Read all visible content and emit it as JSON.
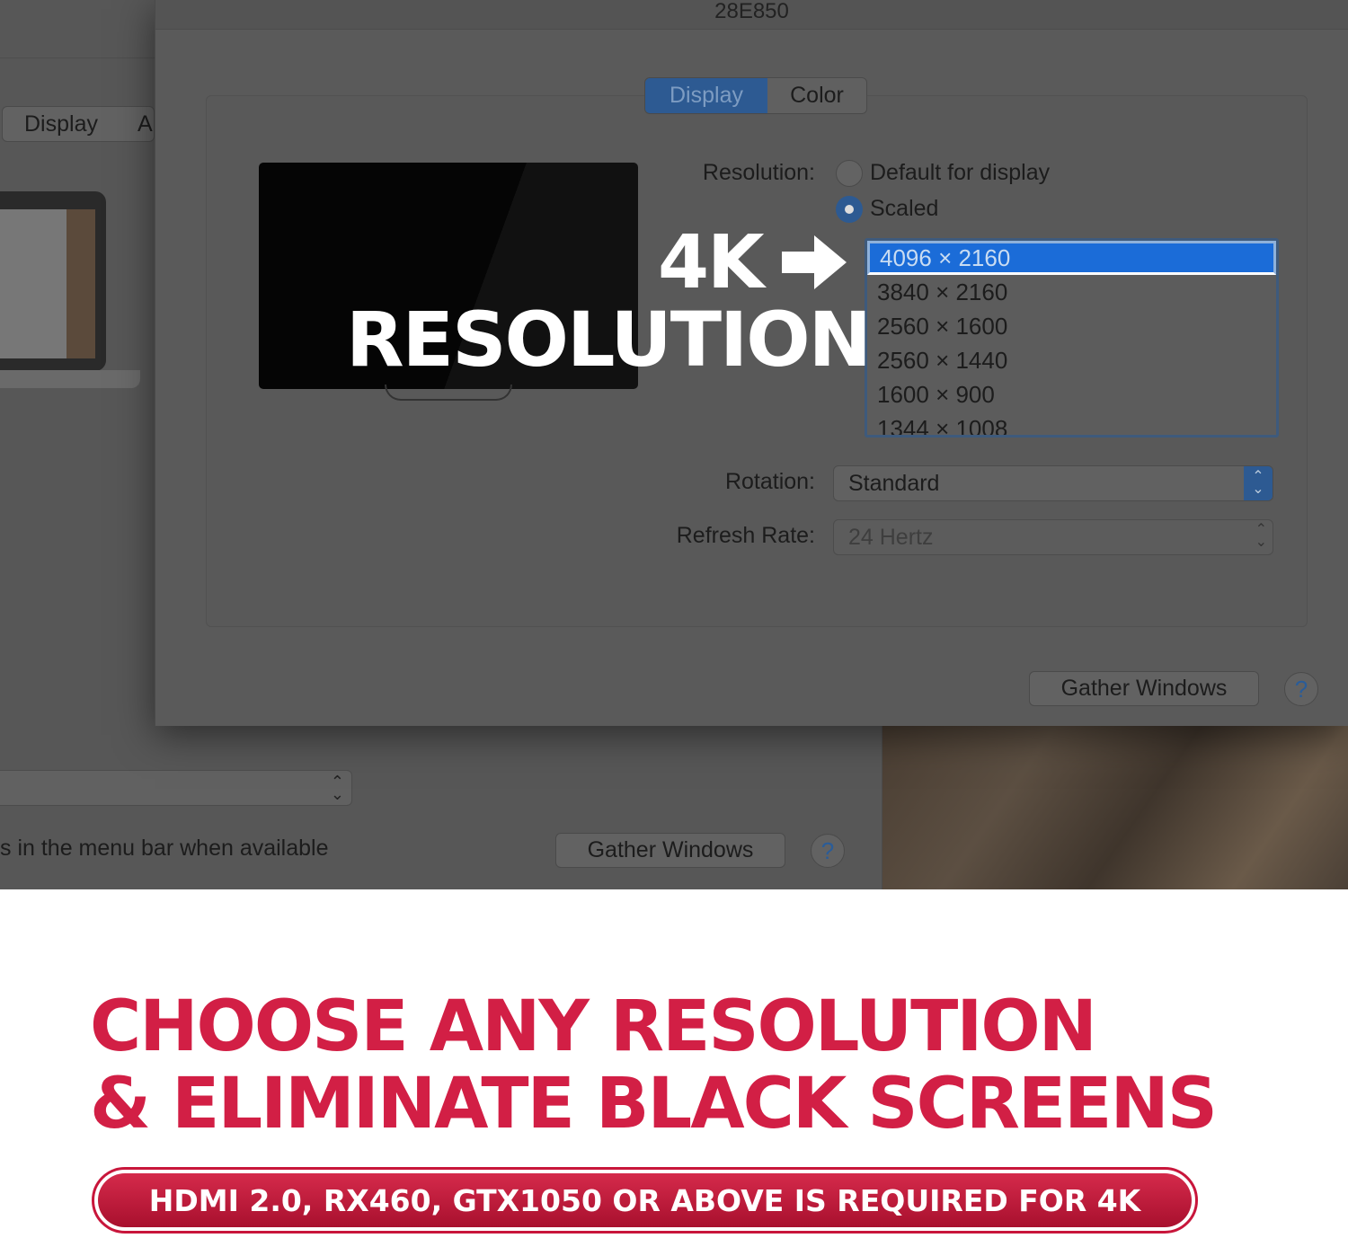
{
  "back_window": {
    "tab_display": "Display",
    "tab_partial": "A",
    "menu_bar_text": "s in the menu bar when available",
    "gather_windows": "Gather Windows",
    "help": "?"
  },
  "front_window": {
    "title": "28E850",
    "tabs": [
      {
        "label": "Display",
        "selected": true
      },
      {
        "label": "Color",
        "selected": false
      }
    ],
    "resolution_label": "Resolution:",
    "radio_default": "Default for display",
    "radio_scaled": "Scaled",
    "resolution_selected": "Scaled",
    "resolutions": [
      "4096 × 2160",
      "3840 × 2160",
      "2560 × 1600",
      "2560 × 1440",
      "1600 × 900",
      "1344 × 1008"
    ],
    "selected_resolution": "4096 × 2160",
    "rotation_label": "Rotation:",
    "rotation_value": "Standard",
    "refresh_label": "Refresh Rate:",
    "refresh_value": "24 Hertz",
    "gather_windows": "Gather Windows",
    "help": "?"
  },
  "overlay": {
    "line1": "4K",
    "line2": "RESOLUTION",
    "arrow_icon": "arrow-right"
  },
  "headline": {
    "line1": "CHOOSE ANY RESOLUTION",
    "line2": "& ELIMINATE BLACK SCREENS"
  },
  "requirement": "HDMI 2.0, RX460, GTX1050 OR ABOVE IS REQUIRED FOR 4K",
  "colors": {
    "accent_red": "#d21f45",
    "selection_blue": "#1b6cd8"
  }
}
